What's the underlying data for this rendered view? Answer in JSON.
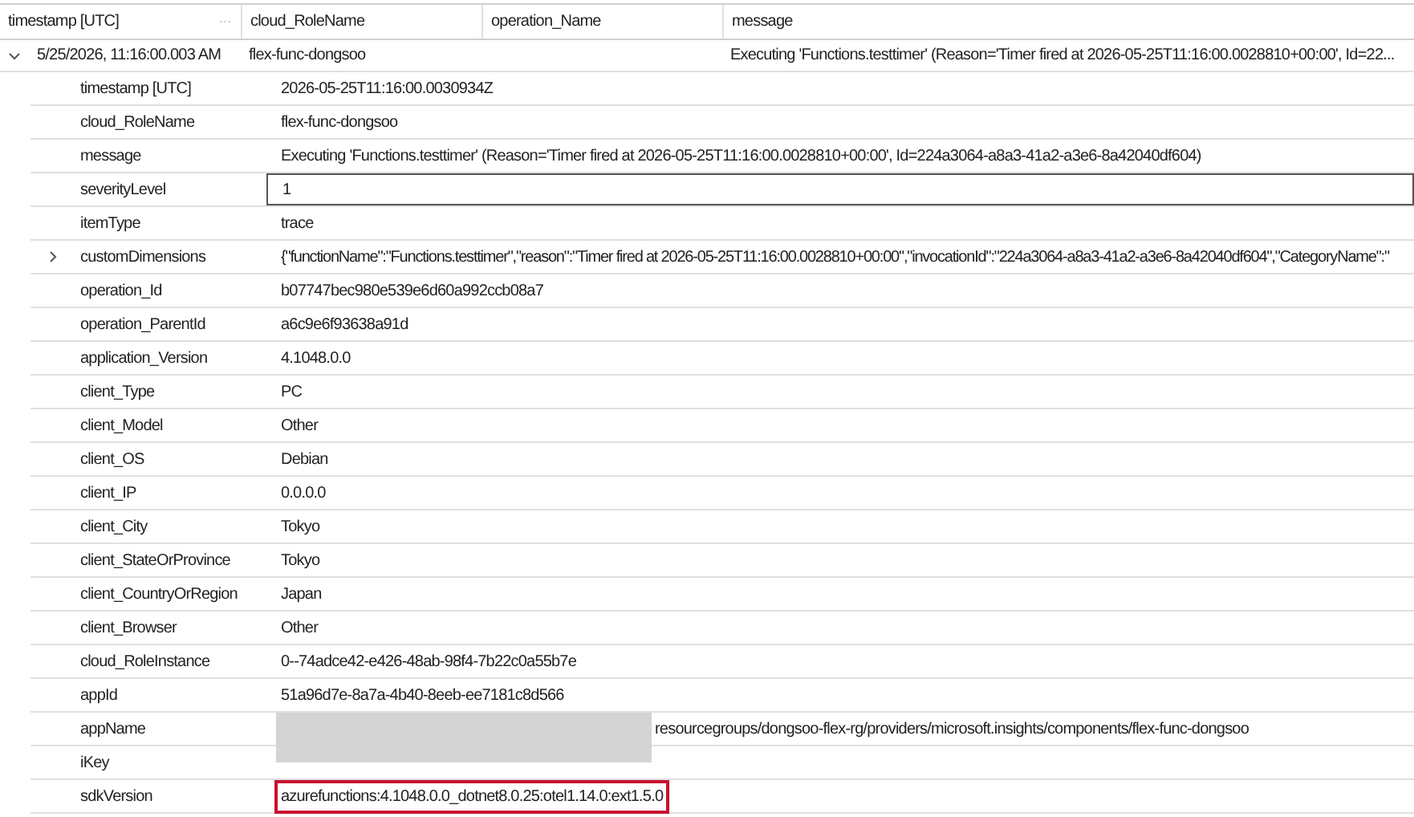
{
  "columns": [
    {
      "label": "timestamp [UTC]",
      "menu": "···"
    },
    {
      "label": "cloud_RoleName"
    },
    {
      "label": "operation_Name"
    },
    {
      "label": "message"
    }
  ],
  "row": {
    "expanded": true,
    "cells": [
      "5/25/2026, 11:16:00.003 AM",
      "flex-func-dongsoo",
      "",
      "Executing 'Functions.testtimer' (Reason='Timer fired at 2026-05-25T11:16:00.0028810+00:00', Id=22..."
    ]
  },
  "details": [
    {
      "key": "timestamp [UTC]",
      "value": "2026-05-25T11:16:00.0030934Z",
      "selected": false
    },
    {
      "key": "cloud_RoleName",
      "value": "flex-func-dongsoo",
      "selected": false
    },
    {
      "key": "message",
      "value": "Executing 'Functions.testtimer' (Reason='Timer fired at 2026-05-25T11:16:00.0028810+00:00', Id=224a3064-a8a3-41a2-a3e6-8a42040df604)",
      "selected": false
    },
    {
      "key": "severityLevel",
      "value": "1",
      "selected": true
    },
    {
      "key": "itemType",
      "value": "trace",
      "selected": false
    },
    {
      "key": "customDimensions",
      "value": "{\"functionName\":\"Functions.testtimer\",\"reason\":\"Timer fired at 2026-05-25T11:16:00.0028810+00:00\",\"invocationId\":\"224a3064-a8a3-41a2-a3e6-8a42040df604\",\"CategoryName\":\"",
      "selected": false,
      "expanded": false
    },
    {
      "key": "operation_Id",
      "value": "b07747bec980e539e6d60a992ccb08a7",
      "selected": false
    },
    {
      "key": "operation_ParentId",
      "value": "a6c9e6f93638a91d",
      "selected": false
    },
    {
      "key": "application_Version",
      "value": "4.1048.0.0",
      "selected": false
    },
    {
      "key": "client_Type",
      "value": "PC",
      "selected": false
    },
    {
      "key": "client_Model",
      "value": "Other",
      "selected": false
    },
    {
      "key": "client_OS",
      "value": "Debian",
      "selected": false
    },
    {
      "key": "client_IP",
      "value": "0.0.0.0",
      "selected": false
    },
    {
      "key": "client_City",
      "value": "Tokyo",
      "selected": false
    },
    {
      "key": "client_StateOrProvince",
      "value": "Tokyo",
      "selected": false
    },
    {
      "key": "client_CountryOrRegion",
      "value": "Japan",
      "selected": false
    },
    {
      "key": "client_Browser",
      "value": "Other",
      "selected": false
    },
    {
      "key": "cloud_RoleInstance",
      "value": "0--74adce42-e426-48ab-98f4-7b22c0a55b7e",
      "selected": false
    },
    {
      "key": "appId",
      "value": "51a96d7e-8a7a-4b40-8eeb-ee7181c8d566",
      "selected": false
    },
    {
      "key": "appName",
      "value": "resourcegroups/dongsoo-flex-rg/providers/microsoft.insights/components/flex-func-dongsoo",
      "selected": false,
      "redacted": true
    },
    {
      "key": "iKey",
      "selected": false
    },
    {
      "key": "sdkVersion",
      "value": "azurefunctions:4.1048.0.0_dotnet8.0.25:otel1.14.0:ext1.5.0",
      "selected": false,
      "highlighted": true
    }
  ]
}
